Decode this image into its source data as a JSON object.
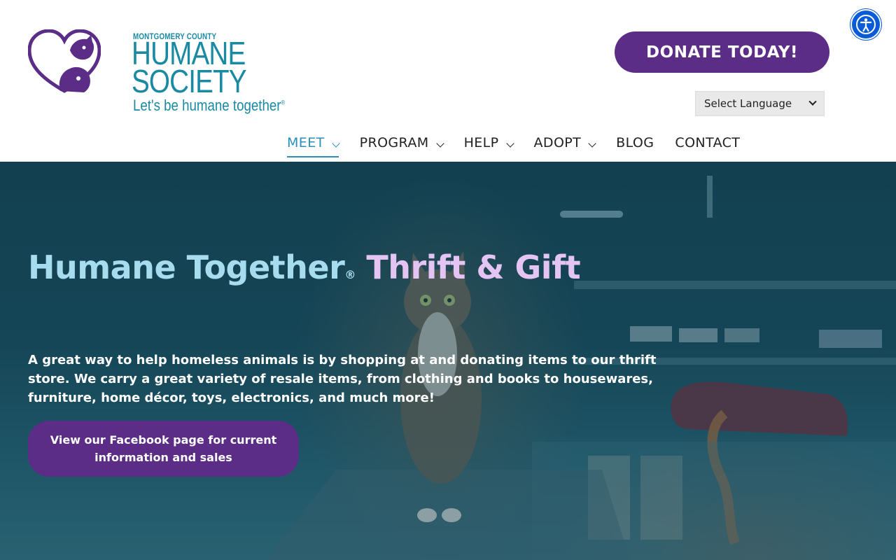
{
  "logo": {
    "county": "MONTGOMERY COUNTY",
    "humane": "HUMANE",
    "society": "SOCIETY",
    "tagline": "Let's be humane together",
    "tagline_mark": "®"
  },
  "header": {
    "donate_label": "DONATE TODAY!",
    "language_select": "Select Language"
  },
  "nav": {
    "items": [
      {
        "label": "MEET"
      },
      {
        "label": "PROGRAM"
      },
      {
        "label": "HELP"
      },
      {
        "label": "ADOPT"
      },
      {
        "label": "BLOG"
      },
      {
        "label": "CONTACT"
      }
    ]
  },
  "hero": {
    "title_part1": "Humane Together",
    "title_reg": "®",
    "title_part2": "Thrift & Gift",
    "description": "A great way to help homeless animals is by shopping at and donating items to our thrift store. We carry a great variety of resale items, from clothing and books to housewares, furniture, home décor, toys, electronics, and much more!",
    "button_label": "View our Facebook page for current information and sales"
  },
  "colors": {
    "brand_purple": "#5b2d86",
    "brand_teal": "#1a8aa3",
    "nav_active": "#2b8fbc",
    "accessibility_blue": "#0a5bd8",
    "hero_title_blue": "#a6dcee",
    "hero_title_pink": "#e4c4f2"
  },
  "icons": {
    "logo_mark": "heart-cat-dog-icon",
    "accessibility": "accessibility-icon",
    "dropdown": "chevron-down-icon"
  }
}
